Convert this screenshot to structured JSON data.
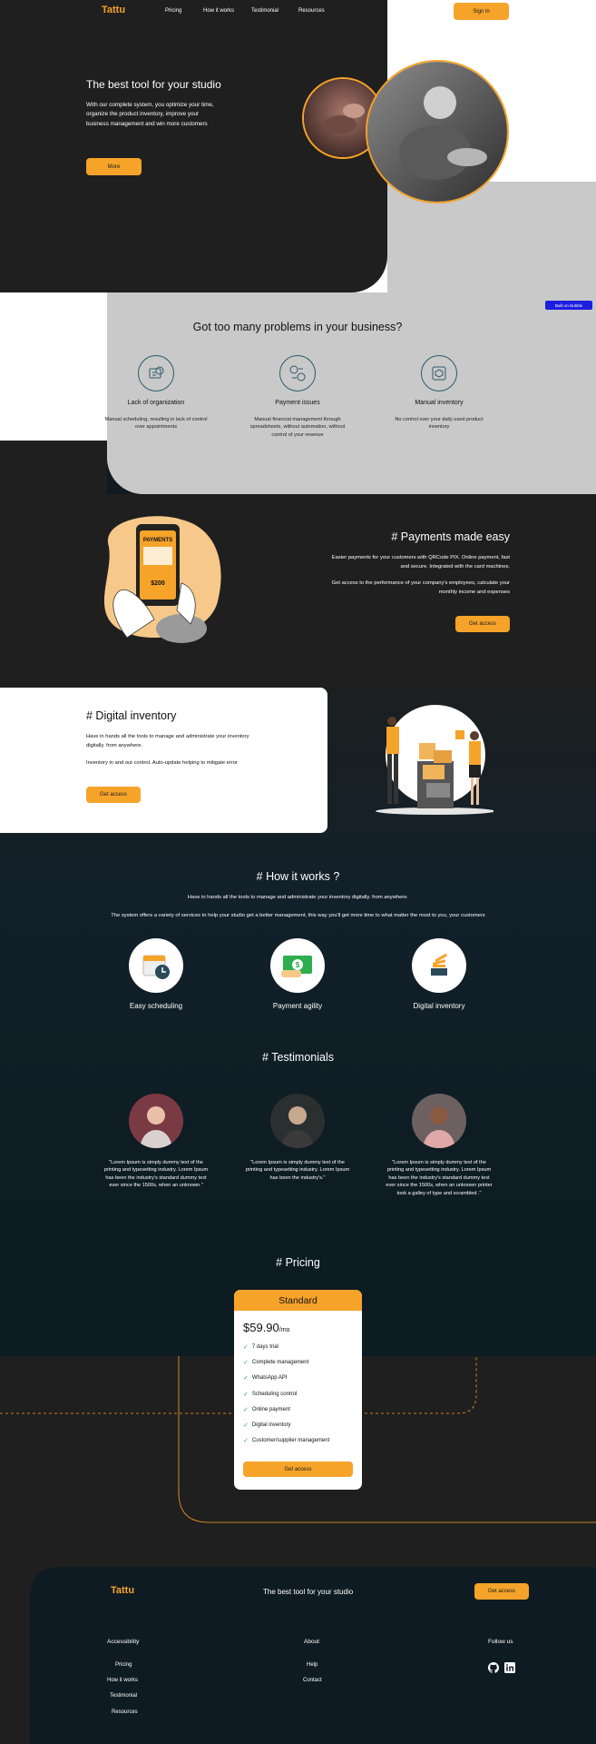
{
  "nav": {
    "logo": "Tattu",
    "links": [
      "Pricing",
      "How it works",
      "Testimonial",
      "Resources"
    ],
    "signin": "Sign in"
  },
  "hero": {
    "title": "The best tool for your studio",
    "text_lines": [
      "With our complete system, you optimize your time,",
      "organize the product inventory, improve your",
      "business management and win more customers"
    ],
    "button": "More"
  },
  "badge": {
    "label": "Built on Bubble"
  },
  "problems": {
    "title": "Got too many problems in your business?",
    "items": [
      {
        "title": "Lack of organization",
        "text": [
          "Manual scheduling, resulting in lack of control",
          "over appointments"
        ]
      },
      {
        "title": "Payment issues",
        "text": [
          "Manual financial management through",
          "spreadsheets, without automation, without",
          "control of your revenue"
        ]
      },
      {
        "title": "Manual inventory",
        "text": [
          "No control over your daily used product",
          "inventory"
        ]
      }
    ]
  },
  "payments": {
    "title": "# Payments made easy",
    "p1": [
      "Easier payments for your customers with QRCode PIX. Online payment, fast",
      "and secure. Integrated with the card machines."
    ],
    "p2": [
      "Get access to the performance of your company's employees, calculate your",
      "monthly income and expenses"
    ],
    "button": "Get access",
    "phone_title": "PAYMENTS",
    "phone_amount": "$200"
  },
  "inventory": {
    "title": "# Digital inventory",
    "p1": [
      "Have in hands all the tools to manage and administrate your inventory",
      "digitally. from anywhere."
    ],
    "p2": "Inventory in and out control. Auto-update helping to mitigate error",
    "button": "Get access"
  },
  "how": {
    "title": "# How it works ?",
    "line1": "Have in hands all the tools to manage and administrate your inventory digitally. from anywhere.",
    "line2": "The system offers a variety of services to help your studio get a better management, this way you'll get more time to what matter the most to you, your customers",
    "items": [
      "Easy scheduling",
      "Payment agility",
      "Digital inventory"
    ]
  },
  "testimonials": {
    "title": "# Testimonials",
    "items": [
      [
        "\"Lorem Ipsum is simply dummy text of the",
        "printing and typesetting industry. Lorem Ipsum",
        "has been the industry's standard dummy text",
        "ever since the 1500s, when an unknown.\""
      ],
      [
        "\"Lorem Ipsum is simply dummy text of the",
        "printing and typesetting industry. Lorem Ipsum",
        "has been the industry's.\""
      ],
      [
        "\"Lorem Ipsum is simply dummy text of the",
        "printing and typesetting industry. Lorem Ipsum",
        "has been the industry's standard dummy text",
        "ever since the 1500s, when an unknown printer",
        "took a galley of type and scrambled .\""
      ]
    ]
  },
  "pricing": {
    "title": "# Pricing",
    "plan": "Standard",
    "price": "$59.90",
    "per": "/mo",
    "features": [
      "7 days trial",
      "Complete management",
      "WhatsApp API",
      "Scheduling control",
      "Online payment",
      "Digital inventory",
      "Customer/supplier management"
    ],
    "button": "Get access"
  },
  "footer": {
    "logo": "Tattu",
    "tagline": "The best tool for your studio",
    "button": "Get access",
    "col1_title": "Accessibility",
    "col1_links": [
      "Pricing",
      "How it works",
      "Testimonial",
      "Resources"
    ],
    "col2_title": "About",
    "col2_links": [
      "Help",
      "Contact"
    ],
    "col3_title": "Follow us"
  },
  "colors": {
    "accent": "#f6a32a",
    "dark": "#201f1f",
    "gray": "#c9c9c9",
    "navy": "#0f1b20"
  }
}
